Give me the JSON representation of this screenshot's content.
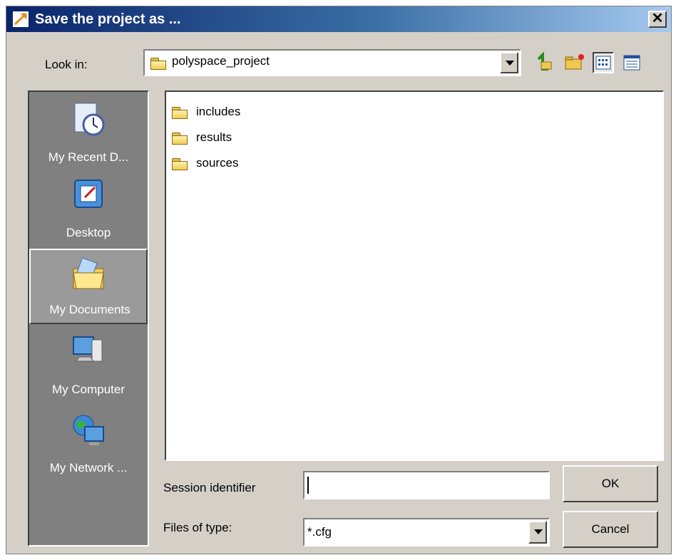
{
  "window": {
    "title": "Save the project as ...",
    "close_glyph": "✕"
  },
  "look_in": {
    "label": "Look in:",
    "value": "polyspace_project"
  },
  "toolbar": {
    "icons": [
      "up-one-level-icon",
      "new-folder-icon",
      "list-view-icon",
      "details-view-icon"
    ]
  },
  "places": [
    {
      "label": "My Recent D...",
      "icon": "recent-documents-icon"
    },
    {
      "label": "Desktop",
      "icon": "desktop-icon"
    },
    {
      "label": "My Documents",
      "icon": "my-documents-icon",
      "selected": true
    },
    {
      "label": "My Computer",
      "icon": "my-computer-icon"
    },
    {
      "label": "My Network ...",
      "icon": "network-icon"
    }
  ],
  "files": [
    {
      "name": "includes",
      "icon": "folder-icon"
    },
    {
      "name": "results",
      "icon": "folder-icon"
    },
    {
      "name": "sources",
      "icon": "folder-icon"
    }
  ],
  "session": {
    "label": "Session identifier",
    "value": ""
  },
  "file_type": {
    "label": "Files of type:",
    "value": "*.cfg"
  },
  "buttons": {
    "ok": "OK",
    "cancel": "Cancel"
  },
  "colors": {
    "titlebar_start": "#0a246a",
    "titlebar_end": "#a6caf0",
    "dialog_bg": "#d4d0c8",
    "places_bg": "#808080"
  }
}
